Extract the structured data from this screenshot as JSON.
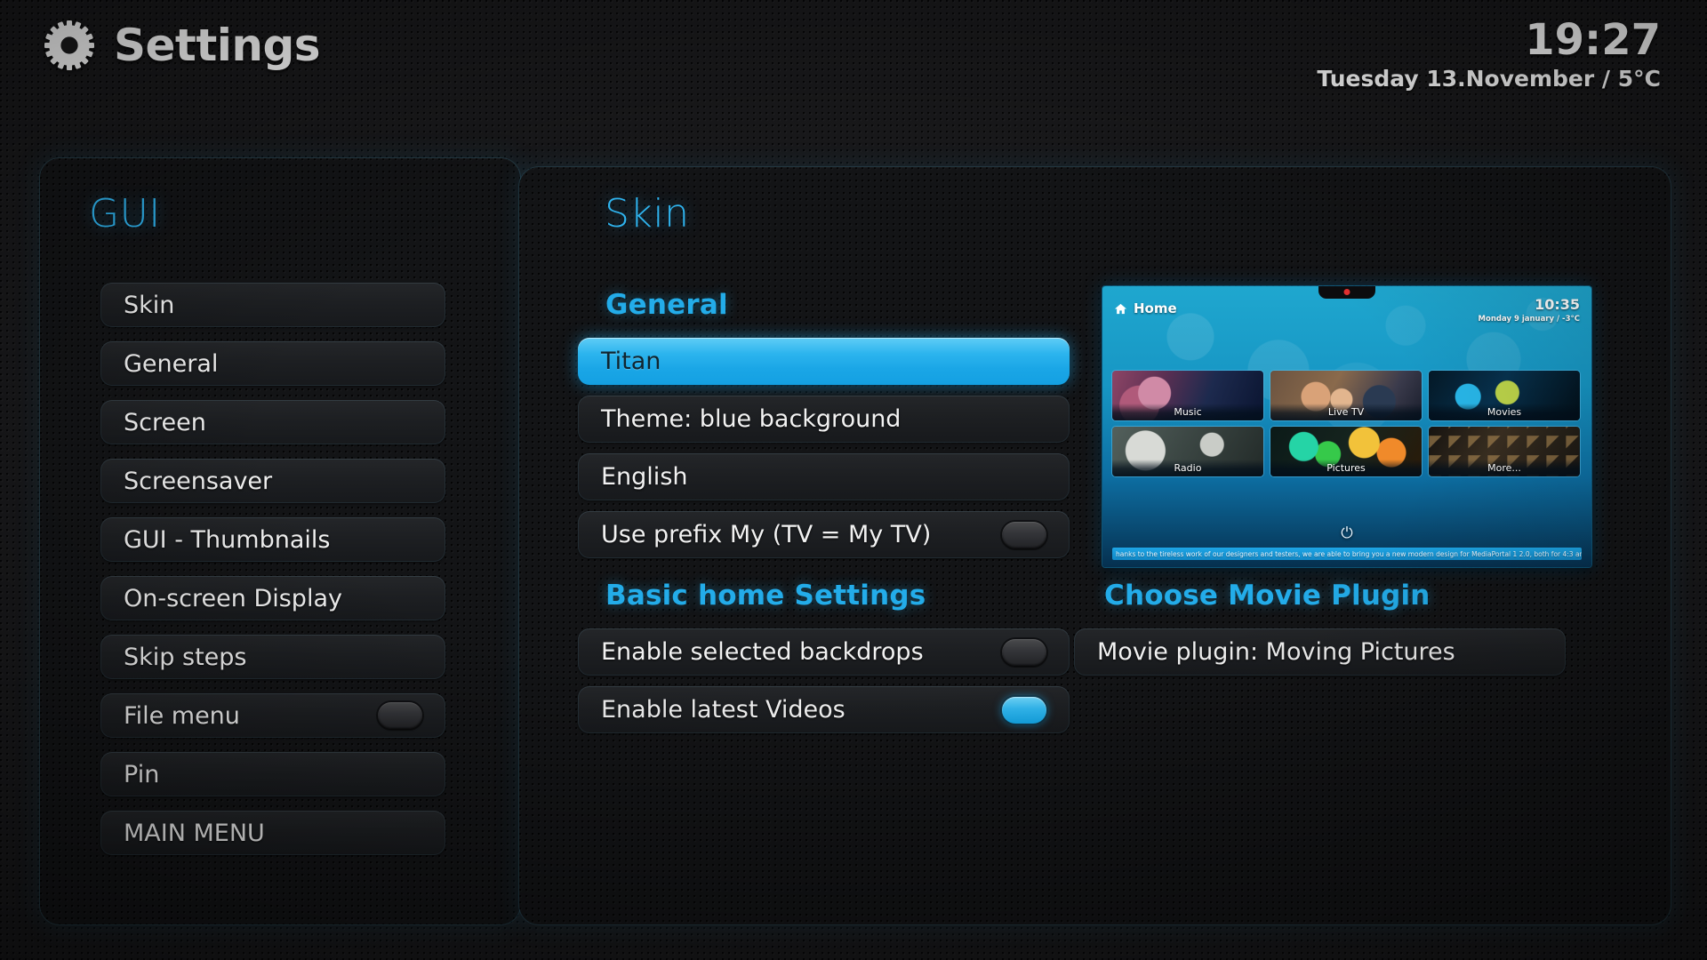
{
  "header": {
    "gear_icon": "gear-icon",
    "title": "Settings",
    "clock": "19:27",
    "date_temp": "Tuesday 13.November / 5°C"
  },
  "sidebar": {
    "title": "GUI",
    "items": [
      {
        "label": "Skin",
        "toggle": null
      },
      {
        "label": "General",
        "toggle": null
      },
      {
        "label": "Screen",
        "toggle": null
      },
      {
        "label": "Screensaver",
        "toggle": null
      },
      {
        "label": "GUI - Thumbnails",
        "toggle": null
      },
      {
        "label": "On-screen Display",
        "toggle": null
      },
      {
        "label": "Skip steps",
        "toggle": null
      },
      {
        "label": "File menu",
        "toggle": "off"
      },
      {
        "label": "Pin",
        "toggle": null
      },
      {
        "label": "MAIN MENU",
        "toggle": null
      }
    ]
  },
  "main": {
    "title": "Skin",
    "sections": {
      "general": {
        "heading": "General",
        "rows": [
          {
            "label": "Titan",
            "selected": true,
            "toggle": null
          },
          {
            "label": "Theme: blue background",
            "selected": false,
            "toggle": null
          },
          {
            "label": "English",
            "selected": false,
            "toggle": null
          },
          {
            "label": "Use prefix My (TV = My TV)",
            "selected": false,
            "toggle": "off"
          }
        ]
      },
      "basic_home": {
        "heading": "Basic home Settings",
        "rows": [
          {
            "label": "Enable selected backdrops",
            "selected": false,
            "toggle": "off"
          },
          {
            "label": "Enable latest Videos",
            "selected": false,
            "toggle": "on"
          }
        ]
      },
      "movie_plugin": {
        "heading": "Choose Movie Plugin",
        "rows": [
          {
            "label": "Movie plugin: Moving Pictures",
            "selected": false,
            "toggle": null
          }
        ]
      }
    }
  },
  "preview": {
    "home_icon": "home-icon",
    "home_label": "Home",
    "clock": "10:35",
    "date_temp": "Monday 9 january / -3°C",
    "tiles": [
      {
        "label": "Music",
        "art": "art-music"
      },
      {
        "label": "Live TV",
        "art": "art-livetv"
      },
      {
        "label": "Movies",
        "art": "art-movies"
      },
      {
        "label": "Radio",
        "art": "art-radio"
      },
      {
        "label": "Pictures",
        "art": "art-pictures"
      },
      {
        "label": "More...",
        "art": "art-more"
      }
    ],
    "power_icon": "power-icon",
    "ticker": "hanks to the tireless work of our designers and testers, we are able to bring you a new modern design for MediaPortal 1 2.0, both for 4:3 an"
  },
  "colors": {
    "accent": "#23ace9",
    "accent_light": "#2fb4ef",
    "panel_bg": "#131416",
    "page_bg": "#19191b",
    "text": "#f2f2f2"
  }
}
